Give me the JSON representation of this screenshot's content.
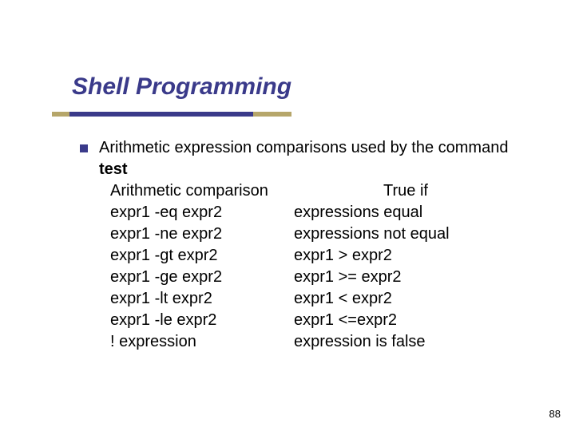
{
  "title": "Shell Programming",
  "lead_part1": "Arithmetic expression comparisons used by the command ",
  "lead_bold": "test",
  "headers": {
    "left": "Arithmetic comparison",
    "right": "True if"
  },
  "rows": [
    {
      "left": "expr1 -eq expr2",
      "right": "expressions equal"
    },
    {
      "left": "expr1 -ne expr2",
      "right": "expressions not equal"
    },
    {
      "left": "expr1 -gt expr2",
      "right": "expr1 > expr2"
    },
    {
      "left": "expr1 -ge expr2",
      "right": "expr1 >= expr2"
    },
    {
      "left": "expr1 -lt expr2",
      "right": "expr1 < expr2"
    },
    {
      "left": "expr1 -le expr2",
      "right": "expr1 <=expr2"
    },
    {
      "left": "! expression",
      "right": "expression is false"
    }
  ],
  "page_number": "88"
}
